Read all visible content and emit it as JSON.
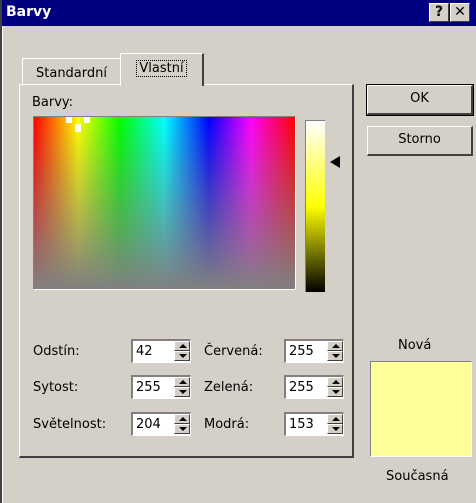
{
  "window": {
    "title": "Barvy",
    "help_glyph": "?",
    "close_glyph": "✕"
  },
  "tabs": [
    {
      "label": "Standardní"
    },
    {
      "label": "Vlastní"
    }
  ],
  "colors_label": "Barvy:",
  "fields": {
    "hue": {
      "label": "Odstín:",
      "value": "42"
    },
    "saturation": {
      "label": "Sytost:",
      "value": "255"
    },
    "luminance": {
      "label": "Světelnost:",
      "value": "204"
    },
    "red": {
      "label": "Červená:",
      "value": "255"
    },
    "green": {
      "label": "Zelená:",
      "value": "255"
    },
    "blue": {
      "label": "Modrá:",
      "value": "153"
    }
  },
  "buttons": {
    "ok": "OK",
    "cancel": "Storno"
  },
  "preview": {
    "new_label": "Nová",
    "current_label": "Současná",
    "color": "#ffff99"
  }
}
